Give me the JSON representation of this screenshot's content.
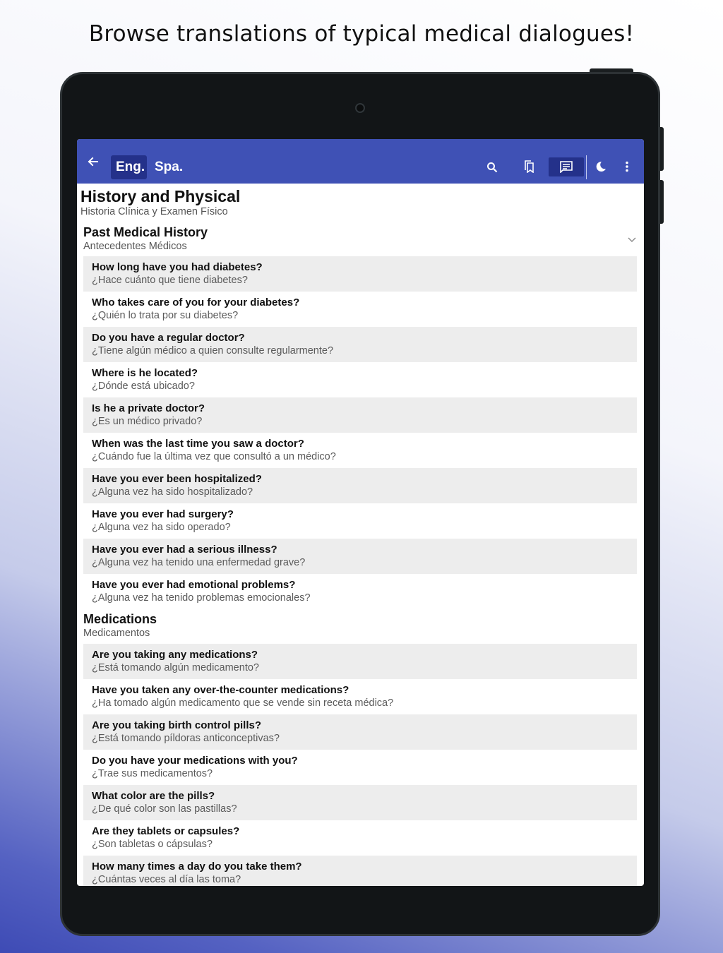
{
  "promo": {
    "title": "Browse translations of typical medical dialogues!"
  },
  "appbar": {
    "lang_primary": "Eng.",
    "lang_secondary": "Spa.",
    "icons": [
      "arrow-back-icon",
      "search-icon",
      "bookmarks-icon",
      "dialogue-icon",
      "dark-mode-icon",
      "more-vert-icon"
    ],
    "accent": "#3f51b5"
  },
  "page": {
    "title": "History and Physical",
    "subtitle": "Historia Clínica y Examen Físico"
  },
  "sections": [
    {
      "title": "Past Medical History",
      "subtitle": "Antecedentes Médicos",
      "items": [
        {
          "en": "How long have you had diabetes?",
          "es": "¿Hace cuánto que tiene diabetes?"
        },
        {
          "en": "Who takes care of you for your diabetes?",
          "es": "¿Quién lo trata por su diabetes?"
        },
        {
          "en": "Do you have a regular doctor?",
          "es": "¿Tiene algún médico a quien consulte regularmente?"
        },
        {
          "en": "Where is he located?",
          "es": "¿Dónde está ubicado?"
        },
        {
          "en": "Is he a private doctor?",
          "es": "¿Es un médico privado?"
        },
        {
          "en": "When was the last time you saw a doctor?",
          "es": "¿Cuándo fue la última vez que consultó a un médico?"
        },
        {
          "en": "Have you ever been hospitalized?",
          "es": "¿Alguna vez ha sido hospitalizado?"
        },
        {
          "en": "Have you ever had surgery?",
          "es": "¿Alguna vez ha sido operado?"
        },
        {
          "en": "Have you ever had a serious illness?",
          "es": "¿Alguna vez ha tenido una enfermedad grave?"
        },
        {
          "en": "Have you ever had emotional problems?",
          "es": "¿Alguna vez ha tenido problemas emocionales?"
        }
      ]
    },
    {
      "title": "Medications",
      "subtitle": "Medicamentos",
      "items": [
        {
          "en": "Are you taking any medications?",
          "es": "¿Está tomando algún medicamento?"
        },
        {
          "en": "Have you taken any over-the-counter medications?",
          "es": "¿Ha tomado algún medicamento que se vende sin receta médica?"
        },
        {
          "en": "Are you taking birth control pills?",
          "es": "¿Está tomando píldoras anticonceptivas?"
        },
        {
          "en": "Do you have your medications with you?",
          "es": "¿Trae sus medicamentos?"
        },
        {
          "en": "What color are the pills?",
          "es": "¿De qué color son las pastillas?"
        },
        {
          "en": "Are they tablets or capsules?",
          "es": "¿Son tabletas o cápsulas?"
        },
        {
          "en": "How many times a day do you take them?",
          "es": "¿Cuántas veces al día las toma?"
        }
      ]
    }
  ]
}
